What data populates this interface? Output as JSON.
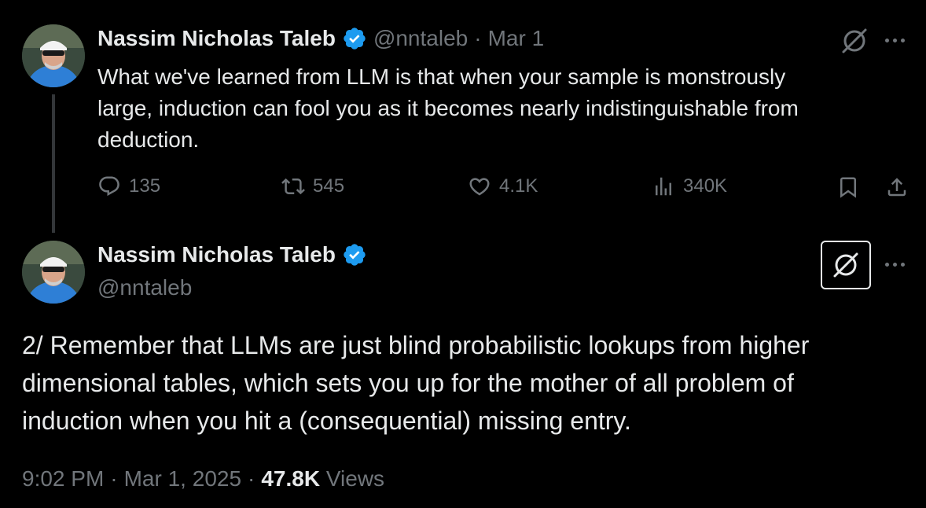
{
  "tweet1": {
    "author_name": "Nassim Nicholas Taleb",
    "handle": "@nntaleb",
    "separator": "·",
    "date": "Mar 1",
    "text_lines": [
      "What we've learned from LLM is that when your sample is monstrously",
      "large, induction can fool you as it becomes nearly indistinguishable from",
      "deduction."
    ],
    "actions": {
      "replies": "135",
      "reposts": "545",
      "likes": "4.1K",
      "views": "340K"
    }
  },
  "tweet2": {
    "author_name": "Nassim Nicholas Taleb",
    "handle": "@nntaleb",
    "text_lines": [
      "2/ Remember that LLMs are just blind probabilistic lookups from higher",
      "dimensional tables, which sets you up for the mother of all problem of",
      "induction when you hit a (consequential) missing entry."
    ],
    "time": "9:02 PM",
    "separator": "·",
    "date": "Mar 1, 2025",
    "views_count": "47.8K",
    "views_label": "Views"
  },
  "colors": {
    "background": "#000000",
    "text": "#e7e9ea",
    "muted": "#71767b",
    "verified": "#1d9bf0"
  },
  "icons": [
    "verified-badge-icon",
    "grok-icon",
    "more-icon",
    "reply-icon",
    "repost-icon",
    "like-icon",
    "views-icon",
    "bookmark-icon",
    "share-icon"
  ]
}
